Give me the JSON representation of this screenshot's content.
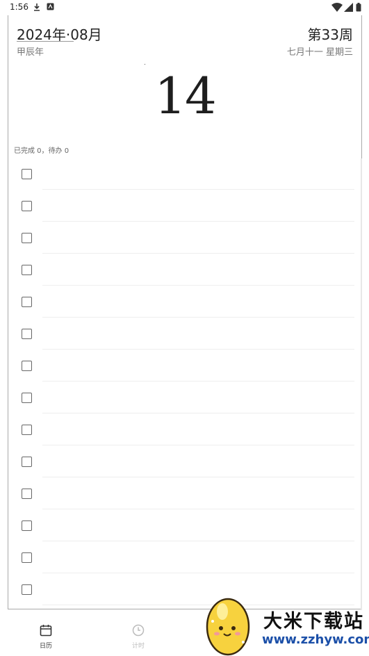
{
  "status_bar": {
    "time": "1:56"
  },
  "header": {
    "year_month": "2024年·08月",
    "week": "第33周",
    "ganzhi_year": "甲辰年",
    "lunar_date": "七月十一  星期三"
  },
  "day": {
    "number": "14"
  },
  "summary": {
    "text": "已完成 0，待办 0"
  },
  "tasks": {
    "count": 14,
    "checked": [
      false,
      false,
      false,
      false,
      false,
      false,
      false,
      false,
      false,
      false,
      false,
      false,
      false,
      false
    ]
  },
  "bottom_nav": {
    "calendar_label": "日历",
    "timer_label": "计时"
  },
  "watermark": {
    "name": "大米下载站",
    "url": "www.zzhyw.com"
  },
  "colors": {
    "text": "#222222",
    "muted": "#777777",
    "watermark_url": "#1b4fa8",
    "egg_yellow": "#f7d23e"
  }
}
